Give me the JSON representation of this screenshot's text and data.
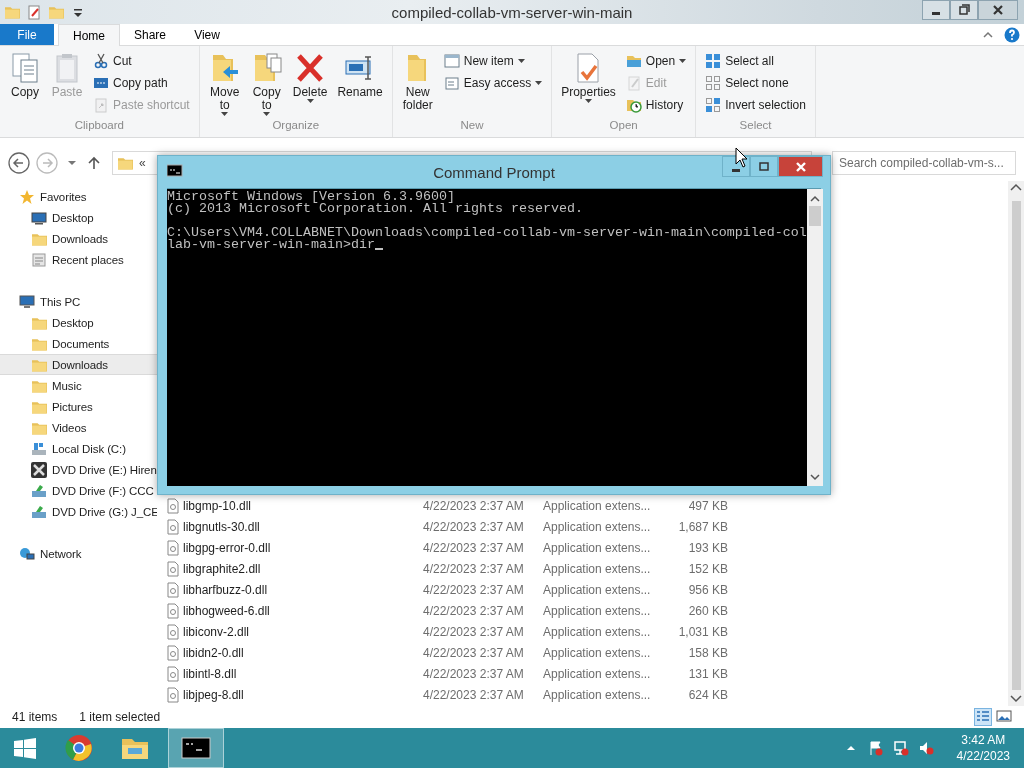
{
  "explorer": {
    "title": "compiled-collab-vm-server-win-main",
    "tabs": [
      {
        "label": "File",
        "kind": "file",
        "selected": false
      },
      {
        "label": "Home",
        "kind": "tab",
        "selected": true
      },
      {
        "label": "Share",
        "kind": "tab",
        "selected": false
      },
      {
        "label": "View",
        "kind": "tab",
        "selected": false
      }
    ],
    "ribbon": [
      {
        "name": "Clipboard",
        "items": [
          {
            "label": "Copy",
            "kind": "large",
            "disabled": false,
            "dropdown": false
          },
          {
            "label": "Paste",
            "kind": "large",
            "disabled": true,
            "dropdown": false
          },
          {
            "label": "Cut",
            "kind": "small",
            "disabled": false,
            "dropdown": false
          },
          {
            "label": "Copy path",
            "kind": "small",
            "disabled": false,
            "dropdown": false
          },
          {
            "label": "Paste shortcut",
            "kind": "small",
            "disabled": true,
            "dropdown": false
          }
        ]
      },
      {
        "name": "Organize",
        "items": [
          {
            "label": "Move to",
            "kind": "large",
            "disabled": false,
            "dropdown": true
          },
          {
            "label": "Copy to",
            "kind": "large",
            "disabled": false,
            "dropdown": true
          },
          {
            "label": "Delete",
            "kind": "large",
            "disabled": false,
            "dropdown": true
          },
          {
            "label": "Rename",
            "kind": "large",
            "disabled": false,
            "dropdown": false
          }
        ]
      },
      {
        "name": "New",
        "items": [
          {
            "label": "New folder",
            "kind": "large",
            "disabled": false,
            "dropdown": false
          },
          {
            "label": "New item",
            "kind": "small",
            "disabled": false,
            "dropdown": true
          },
          {
            "label": "Easy access",
            "kind": "small",
            "disabled": false,
            "dropdown": true
          }
        ]
      },
      {
        "name": "Open",
        "items": [
          {
            "label": "Properties",
            "kind": "large",
            "disabled": false,
            "dropdown": true
          },
          {
            "label": "Open",
            "kind": "small",
            "disabled": false,
            "dropdown": true
          },
          {
            "label": "Edit",
            "kind": "small",
            "disabled": true,
            "dropdown": false
          },
          {
            "label": "History",
            "kind": "small",
            "disabled": false,
            "dropdown": false
          }
        ]
      },
      {
        "name": "Select",
        "items": [
          {
            "label": "Select all",
            "kind": "small",
            "disabled": false,
            "dropdown": false
          },
          {
            "label": "Select none",
            "kind": "small",
            "disabled": false,
            "dropdown": false
          },
          {
            "label": "Invert selection",
            "kind": "small",
            "disabled": false,
            "dropdown": false
          }
        ]
      }
    ],
    "address": {
      "chevron": "«"
    },
    "search": {
      "placeholder": "Search compiled-collab-vm-s..."
    },
    "sidebar": [
      {
        "label": "Favorites",
        "selected": false,
        "children": [
          {
            "label": "Desktop",
            "selected": false
          },
          {
            "label": "Downloads",
            "selected": false
          },
          {
            "label": "Recent places",
            "selected": false
          }
        ]
      },
      {
        "label": "This PC",
        "selected": false,
        "children": [
          {
            "label": "Desktop",
            "selected": false
          },
          {
            "label": "Documents",
            "selected": false
          },
          {
            "label": "Downloads",
            "selected": true
          },
          {
            "label": "Music",
            "selected": false
          },
          {
            "label": "Pictures",
            "selected": false
          },
          {
            "label": "Videos",
            "selected": false
          },
          {
            "label": "Local Disk (C:)",
            "selected": false
          },
          {
            "label": "DVD Drive (E:) Hiren",
            "selected": false
          },
          {
            "label": "DVD Drive (F:) CCC",
            "selected": false
          },
          {
            "label": "DVD Drive (G:) J_CE",
            "selected": false
          }
        ]
      },
      {
        "label": "Network",
        "selected": false
      }
    ],
    "files": [
      {
        "name": "libgmp-10.dll",
        "date": "4/22/2023 2:37 AM",
        "type": "Application extens...",
        "size": "497 KB"
      },
      {
        "name": "libgnutls-30.dll",
        "date": "4/22/2023 2:37 AM",
        "type": "Application extens...",
        "size": "1,687 KB"
      },
      {
        "name": "libgpg-error-0.dll",
        "date": "4/22/2023 2:37 AM",
        "type": "Application extens...",
        "size": "193 KB"
      },
      {
        "name": "libgraphite2.dll",
        "date": "4/22/2023 2:37 AM",
        "type": "Application extens...",
        "size": "152 KB"
      },
      {
        "name": "libharfbuzz-0.dll",
        "date": "4/22/2023 2:37 AM",
        "type": "Application extens...",
        "size": "956 KB"
      },
      {
        "name": "libhogweed-6.dll",
        "date": "4/22/2023 2:37 AM",
        "type": "Application extens...",
        "size": "260 KB"
      },
      {
        "name": "libiconv-2.dll",
        "date": "4/22/2023 2:37 AM",
        "type": "Application extens...",
        "size": "1,031 KB"
      },
      {
        "name": "libidn2-0.dll",
        "date": "4/22/2023 2:37 AM",
        "type": "Application extens...",
        "size": "158 KB"
      },
      {
        "name": "libintl-8.dll",
        "date": "4/22/2023 2:37 AM",
        "type": "Application extens...",
        "size": "131 KB"
      },
      {
        "name": "libjpeg-8.dll",
        "date": "4/22/2023 2:37 AM",
        "type": "Application extens...",
        "size": "624 KB"
      }
    ],
    "status_bar": {
      "item_count": "41 items",
      "selection": "1 item selected"
    }
  },
  "command_prompt": {
    "title": "Command Prompt",
    "paragraphs": [
      [
        "Microsoft Windows [Version 6.3.9600]",
        "(c) 2013 Microsoft Corporation. All rights reserved."
      ],
      [
        "C:\\Users\\VM4.COLLABNET\\Downloads\\compiled-collab-vm-server-win-main\\compiled-col",
        "lab-vm-server-win-main>dir"
      ]
    ],
    "cursor": true
  },
  "taskbar": {
    "apps": [
      {
        "selected": false
      },
      {
        "selected": false
      },
      {
        "selected": true
      }
    ],
    "time": "3:42 AM",
    "date": "4/22/2023"
  }
}
